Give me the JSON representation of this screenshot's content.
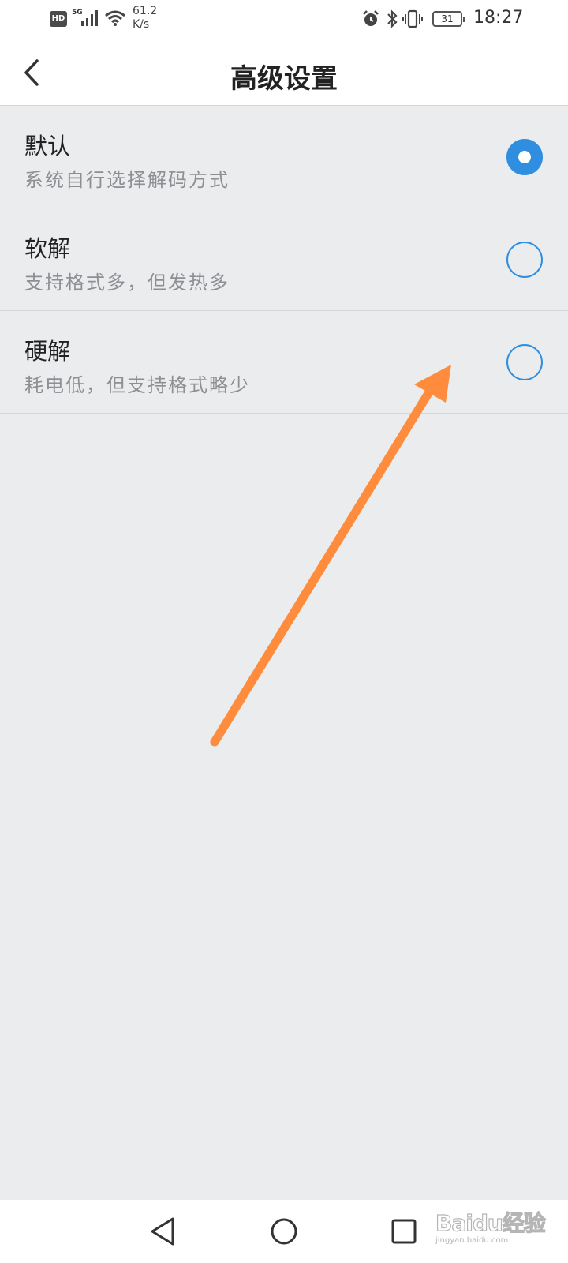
{
  "status_bar": {
    "hd_badge": "HD",
    "network": "5G",
    "speed_value": "61.2",
    "speed_unit": "K/s",
    "battery": "31",
    "time": "18:27"
  },
  "header": {
    "title": "高级设置"
  },
  "options": [
    {
      "title": "默认",
      "desc": "系统自行选择解码方式",
      "selected": true
    },
    {
      "title": "软解",
      "desc": "支持格式多，但发热多",
      "selected": false
    },
    {
      "title": "硬解",
      "desc": "耗电低，但支持格式略少",
      "selected": false
    }
  ],
  "watermark": {
    "logo": "Baidu经验",
    "url": "jingyan.baidu.com"
  },
  "colors": {
    "accent": "#2f8ee0",
    "annotation_arrow": "#ff8c3c",
    "background": "#ebecee"
  }
}
